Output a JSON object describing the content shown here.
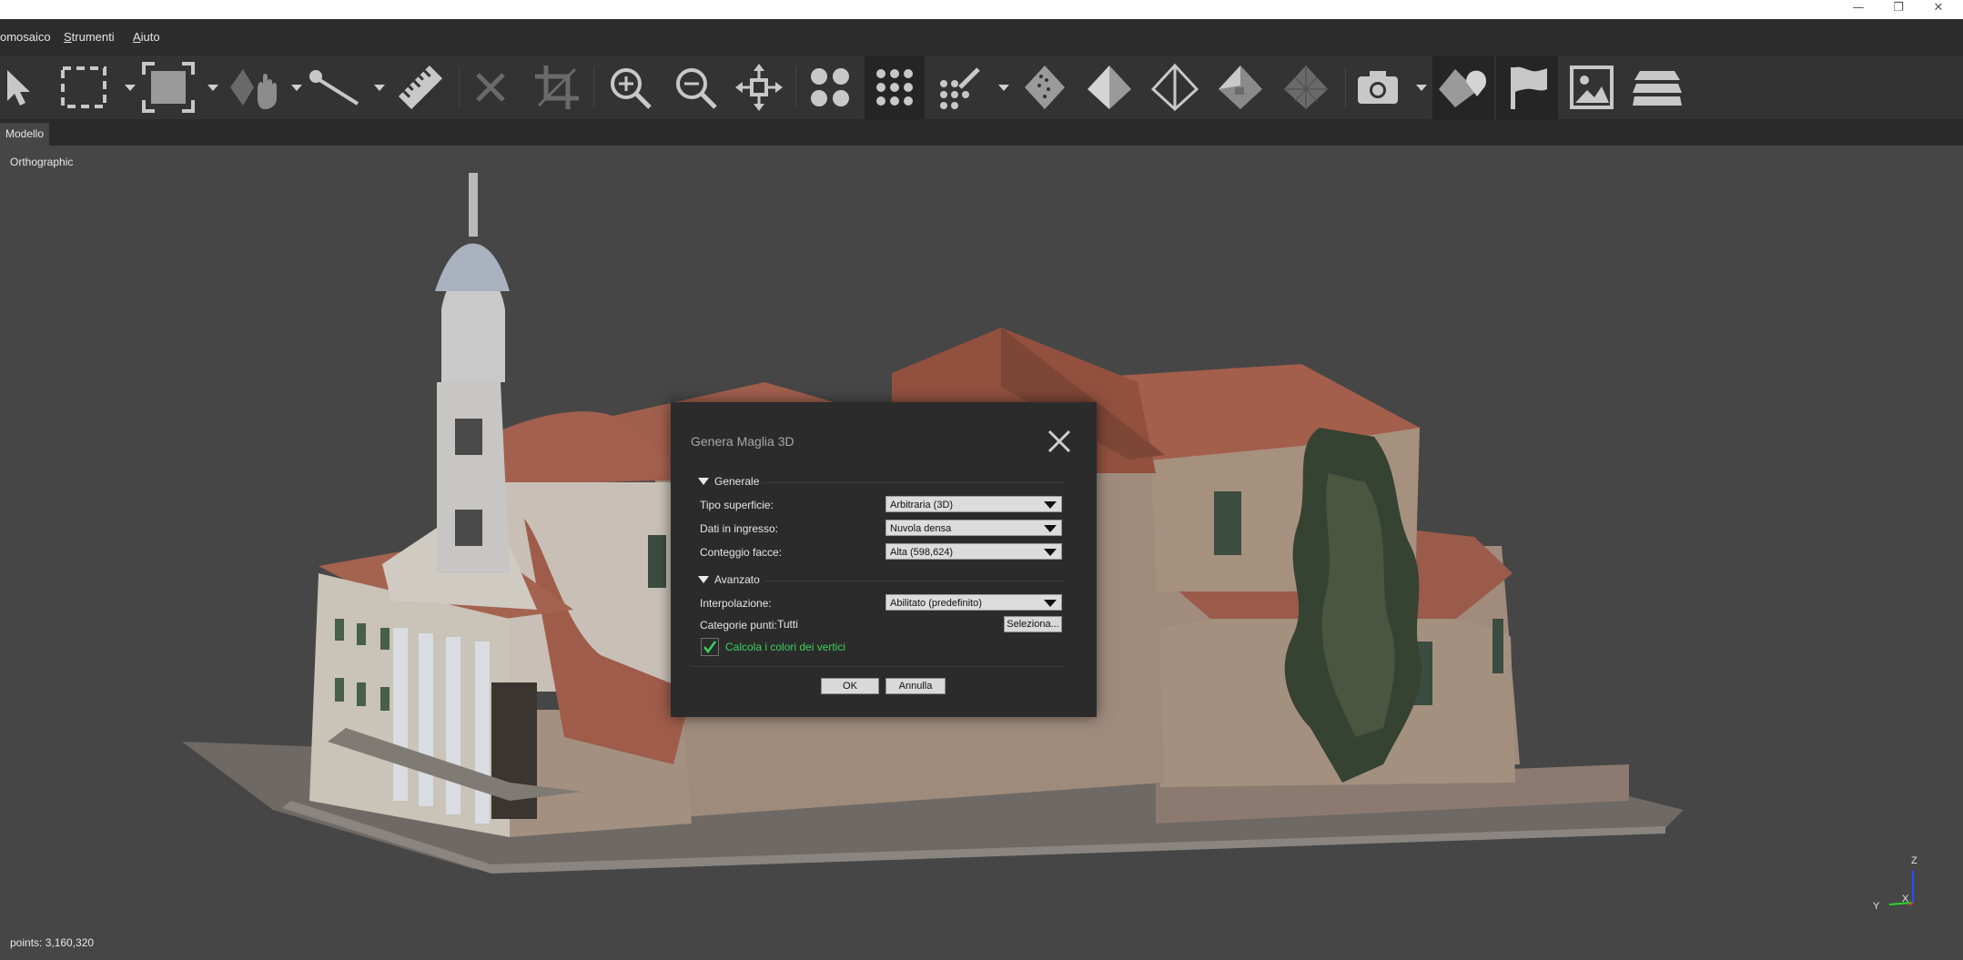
{
  "window": {
    "controls": {
      "minimize": "—",
      "restore": "❐",
      "close": "✕"
    }
  },
  "menubar": {
    "items": [
      {
        "label": "omosaico",
        "mnemonic": ""
      },
      {
        "label": "Strumenti",
        "mnemonic": "S"
      },
      {
        "label": "Aiuto",
        "mnemonic": "A"
      }
    ]
  },
  "toolbar": {
    "icons": [
      "navigation-pointer-icon",
      "rectangle-selection-icon",
      "resize-region-icon",
      "rotate-pan-icon",
      "ruler-measure-icon",
      "delete-selection-icon",
      "crop-selection-icon",
      "zoom-in-icon",
      "zoom-out-icon",
      "reset-view-icon",
      "show-cameras-icon",
      "dense-cloud-points-icon",
      "classify-points-icon",
      "solid-model-icon",
      "shaded-model-icon",
      "wireframe-model-icon",
      "textured-model-icon",
      "tiled-model-icon",
      "capture-view-icon",
      "show-region-icon",
      "show-markers-icon",
      "show-images-icon",
      "show-layers-icon"
    ],
    "active": [
      "dense-cloud-points-icon",
      "show-region-icon",
      "show-markers-icon"
    ]
  },
  "tabs": [
    {
      "label": "Modello",
      "active": true
    }
  ],
  "viewport": {
    "projection_label": "Orthographic",
    "points_label": "points: 3,160,320",
    "axes": {
      "z": "Z",
      "y": "Y",
      "x": "X"
    },
    "axis_colors": {
      "z": "#2b49ff",
      "y": "#2bd42b",
      "x": "#e03030"
    }
  },
  "dialog": {
    "title": "Genera Maglia 3D",
    "sections": {
      "general": {
        "label": "Generale",
        "surface_type_label": "Tipo superficie:",
        "surface_type_value": "Arbitraria (3D)",
        "source_data_label": "Dati in ingresso:",
        "source_data_value": "Nuvola densa",
        "face_count_label": "Conteggio facce:",
        "face_count_value": "Alta (598,624)"
      },
      "advanced": {
        "label": "Avanzato",
        "interpolation_label": "Interpolazione:",
        "interpolation_value": "Abilitato (predefinito)",
        "point_classes_label": "Categorie punti:",
        "point_classes_value": "Tutti",
        "select_button": "Seleziona...",
        "vertex_colors_label": "Calcola i colori dei vertici",
        "vertex_colors_checked": true
      }
    },
    "ok_label": "OK",
    "cancel_label": "Annulla",
    "accent_color": "#39d25e"
  }
}
